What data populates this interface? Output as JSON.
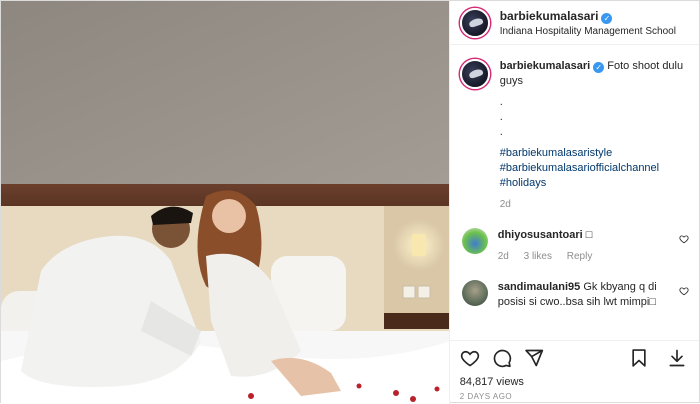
{
  "header": {
    "username": "barbiekumalasari",
    "location": "Indiana Hospitality Management School"
  },
  "caption": {
    "username": "barbiekumalasari",
    "text": "Foto shoot dulu guys",
    "dots": [
      ".",
      ".",
      "."
    ],
    "hashtags": [
      "#barbiekumalasaristyle",
      "#barbiekumalasariofficialchannel",
      "#holidays"
    ],
    "time": "2d"
  },
  "comments": [
    {
      "username": "dhiyosusantoari",
      "text": "□",
      "time": "2d",
      "likes": "3 likes",
      "reply": "Reply",
      "avatar_color": "#4caf50"
    },
    {
      "username": "sandimaulani95",
      "text": "Gk kbyang q di posisi si cwo..bsa sih lwt mimpi□",
      "avatar_color": "#5d6d5a"
    }
  ],
  "stats": {
    "views": "84,817 views",
    "posted": "2 DAYS AGO"
  },
  "icons": [
    "heart-icon",
    "comment-icon",
    "share-icon",
    "bookmark-icon",
    "download-icon",
    "verified-icon"
  ],
  "colors": {
    "verified": "#3897f0",
    "hashtag": "#00376b",
    "muted": "#8e8e8e"
  }
}
